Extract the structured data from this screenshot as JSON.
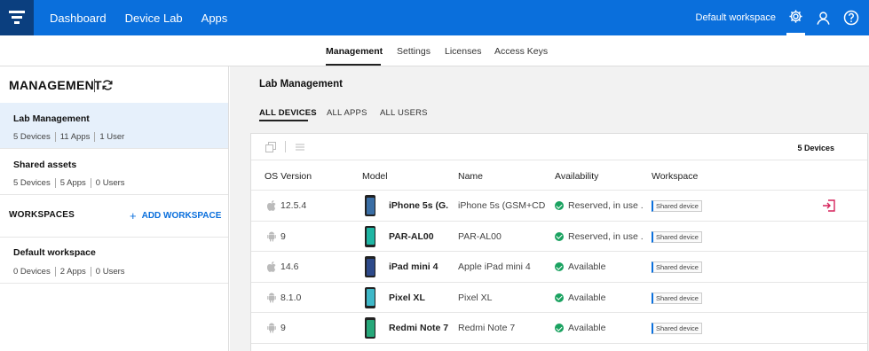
{
  "topbar": {
    "nav": [
      "Dashboard",
      "Device Lab",
      "Apps"
    ],
    "workspace": "Default workspace",
    "colors": {
      "bar": "#0a6fdc",
      "logo_bg": "#0b3f7f"
    },
    "icons": [
      "settings-icon",
      "user-icon",
      "help-icon"
    ]
  },
  "subnav": {
    "tabs": [
      "Management",
      "Settings",
      "Licenses",
      "Access Keys"
    ],
    "active": "Management"
  },
  "sidebar": {
    "title": "MANAGEMENT",
    "items": [
      {
        "name": "Lab Management",
        "meta": [
          "5 Devices",
          "11 Apps",
          "1 User"
        ],
        "selected": true
      },
      {
        "name": "Shared assets",
        "meta": [
          "5 Devices",
          "5 Apps",
          "0 Users"
        ],
        "selected": false
      }
    ],
    "workspaces_title": "WORKSPACES",
    "add_workspace": "ADD WORKSPACE",
    "workspaces": [
      {
        "name": "Default workspace",
        "meta": [
          "0 Devices",
          "2 Apps",
          "0 Users"
        ]
      }
    ]
  },
  "main": {
    "title": "Lab Management",
    "tabs": [
      "ALL DEVICES",
      "ALL APPS",
      "ALL USERS"
    ],
    "active_tab": "ALL DEVICES",
    "device_count": "5 Devices",
    "columns": [
      "OS Version",
      "Model",
      "Name",
      "Availability",
      "Workspace"
    ],
    "rows": [
      {
        "os": "apple",
        "os_version": "12.5.4",
        "model": "iPhone 5s (G...",
        "name": "iPhone 5s (GSM+CD...",
        "availability": "Reserved, in use ...",
        "workspace": "Shared device",
        "phone_color": "#3a6ea5"
      },
      {
        "os": "android",
        "os_version": "9",
        "model": "PAR-AL00",
        "name": "PAR-AL00",
        "availability": "Reserved, in use ...",
        "workspace": "Shared device",
        "phone_color": "#1fb5a3"
      },
      {
        "os": "apple",
        "os_version": "14.6",
        "model": "iPad mini 4",
        "name": "Apple iPad mini 4",
        "availability": "Available",
        "workspace": "Shared device",
        "phone_color": "#2d4a8a"
      },
      {
        "os": "android",
        "os_version": "8.1.0",
        "model": "Pixel XL",
        "name": "Pixel XL",
        "availability": "Available",
        "workspace": "Shared device",
        "phone_color": "#3fb8c8"
      },
      {
        "os": "android",
        "os_version": "9",
        "model": "Redmi Note 7",
        "name": "Redmi Note 7",
        "availability": "Available",
        "workspace": "Shared device",
        "phone_color": "#27a87a"
      }
    ]
  }
}
